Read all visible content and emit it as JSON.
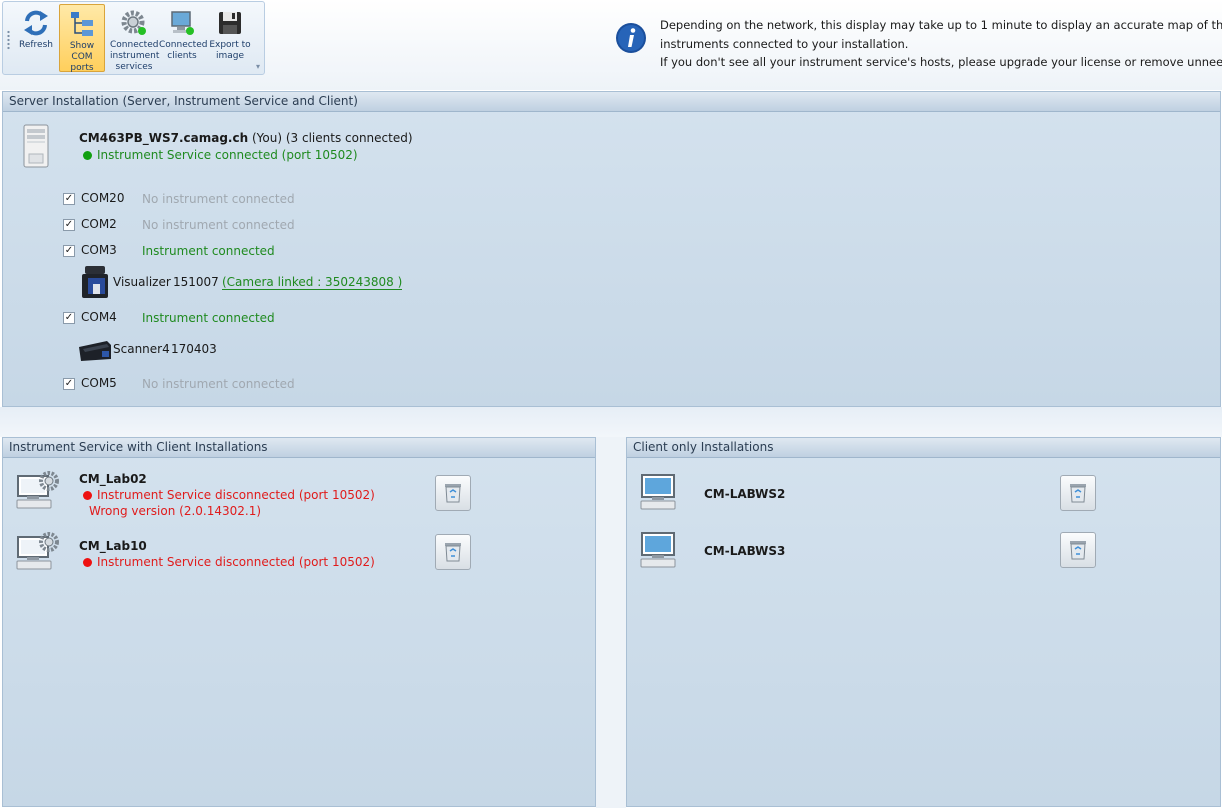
{
  "toolbar": {
    "refresh": "Refresh",
    "show_com_ports": [
      "Show COM",
      "ports"
    ],
    "connected_instrument_services": [
      "Connected",
      "instrument",
      "services"
    ],
    "connected_clients": [
      "Connected",
      "clients"
    ],
    "export_to_image": [
      "Export to",
      "image"
    ]
  },
  "info": {
    "line1": "Depending on the network, this display may take up to 1 minute to display an accurate map of the Camag",
    "line2": "instruments connected to your installation.",
    "line3": "If you don't see all your instrument service's hosts, please upgrade your license or remove unneeded host."
  },
  "server_panel": {
    "title": "Server Installation (Server, Instrument Service and Client)",
    "host": "CM463PB_WS7.camag.ch",
    "you": "(You)",
    "clients": "(3 clients connected)",
    "service_status": "Instrument Service connected (port 10502)",
    "ports": [
      {
        "name": "COM20",
        "status": "No instrument connected",
        "checked": true
      },
      {
        "name": "COM2",
        "status": "No instrument connected",
        "checked": true
      },
      {
        "name": "COM3",
        "status": "Instrument connected",
        "checked": true
      },
      {
        "name": "COM4",
        "status": "Instrument connected",
        "checked": true
      },
      {
        "name": "COM5",
        "status": "No instrument connected",
        "checked": true
      }
    ],
    "check_mark": "✓",
    "visualizer": {
      "name": "Visualizer",
      "serial": "151007",
      "camera": "(Camera linked :  350243808 )"
    },
    "scanner": {
      "name": "Scanner4",
      "serial": "170403"
    }
  },
  "service_panel": {
    "title": "Instrument Service with Client Installations",
    "hosts": [
      {
        "name": "CM_Lab02",
        "status": "Instrument Service disconnected (port 10502)",
        "extra": "Wrong version (2.0.14302.1)"
      },
      {
        "name": "CM_Lab10",
        "status": "Instrument Service disconnected (port 10502)",
        "extra": ""
      }
    ]
  },
  "client_panel": {
    "title": "Client only Installations",
    "hosts": [
      {
        "name": "CM-LABWS2"
      },
      {
        "name": "CM-LABWS3"
      }
    ]
  },
  "colors": {
    "connected": "#1f8a1f",
    "disconnected": "#e01b1b",
    "idle": "#a0a8b0",
    "active_button": "#ffcf5c"
  }
}
